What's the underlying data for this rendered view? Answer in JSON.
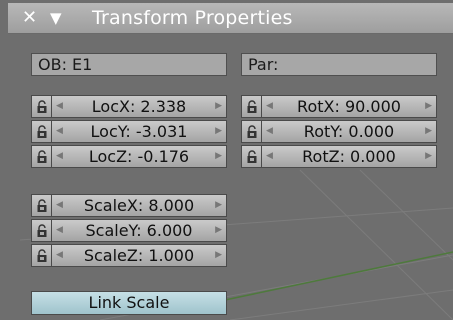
{
  "header": {
    "close_icon": "✕",
    "collapse_icon": "▼",
    "title": "Transform Properties"
  },
  "object_field": "OB: E1",
  "parent_field": "Par:",
  "location": [
    {
      "label": "LocX: 2.338"
    },
    {
      "label": "LocY: -3.031"
    },
    {
      "label": "LocZ: -0.176"
    }
  ],
  "rotation": [
    {
      "label": "RotX: 90.000"
    },
    {
      "label": "RotY: 0.000"
    },
    {
      "label": "RotZ: 0.000"
    }
  ],
  "scale": [
    {
      "label": "ScaleX: 8.000"
    },
    {
      "label": "ScaleY: 6.000"
    },
    {
      "label": "ScaleZ: 1.000"
    }
  ],
  "link_scale_label": "Link Scale",
  "colors": {
    "panel_bg": "#6e6e6e",
    "header_bg": "#a8a8a8",
    "link_button": "#b3d3da",
    "grid_line": "#4e7a3c"
  },
  "icons": {
    "lock": "lock-icon",
    "decrement": "arrow-left-icon",
    "increment": "arrow-right-icon"
  }
}
